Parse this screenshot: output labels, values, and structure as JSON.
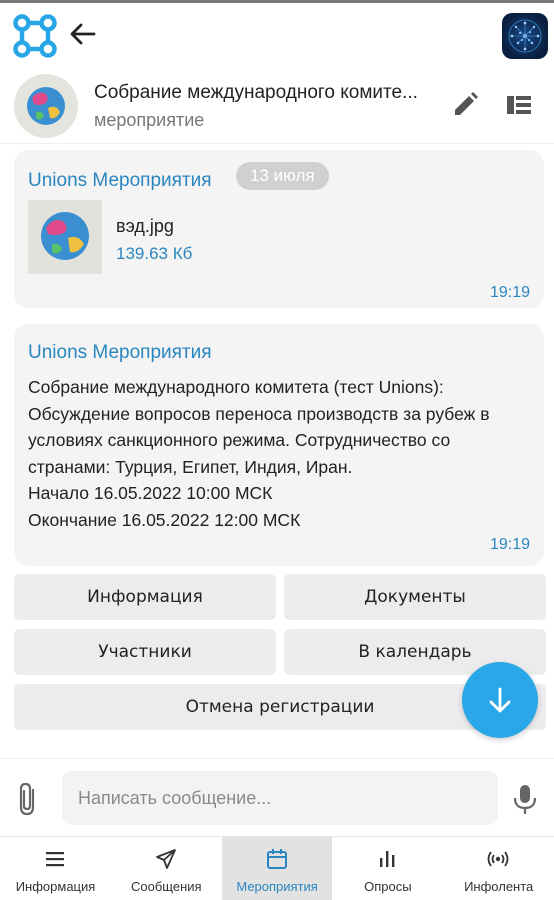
{
  "header": {
    "chat_title": "Собрание международного комите...",
    "chat_subtitle": "мероприятие"
  },
  "messages": [
    {
      "sender": "Unions Мероприятия",
      "date_badge": "13 июля",
      "file_name": "вэд.jpg",
      "file_size": "139.63 Кб",
      "time": "19:19"
    },
    {
      "sender": "Unions Мероприятия",
      "lines": [
        "Собрание международного комитета (тест Unions):",
        "Обсуждение вопросов переноса производств за рубеж в",
        "условиях санкционного режима. Сотрудничество со",
        "странами: Турция, Египет, Индия, Иран.",
        "Начало 16.05.2022 10:00 МСК",
        "Окончание 16.05.2022 12:00 МСК"
      ],
      "time": "19:19"
    }
  ],
  "action_buttons": {
    "info": "Информация",
    "documents": "Документы",
    "participants": "Участники",
    "calendar": "В календарь",
    "cancel_registration": "Отмена регистрации"
  },
  "composer": {
    "placeholder": "Написать сообщение..."
  },
  "bottom_nav": [
    {
      "label": "Информация",
      "icon": "menu-icon"
    },
    {
      "label": "Сообщения",
      "icon": "send-icon"
    },
    {
      "label": "Мероприятия",
      "icon": "calendar-icon",
      "active": true
    },
    {
      "label": "Опросы",
      "icon": "bar-chart-icon"
    },
    {
      "label": "Инфолента",
      "icon": "broadcast-icon"
    }
  ],
  "colors": {
    "accent": "#2a86c0",
    "fab": "#2aa7e8",
    "bubble": "#f4f4f4",
    "button": "#ececec"
  }
}
